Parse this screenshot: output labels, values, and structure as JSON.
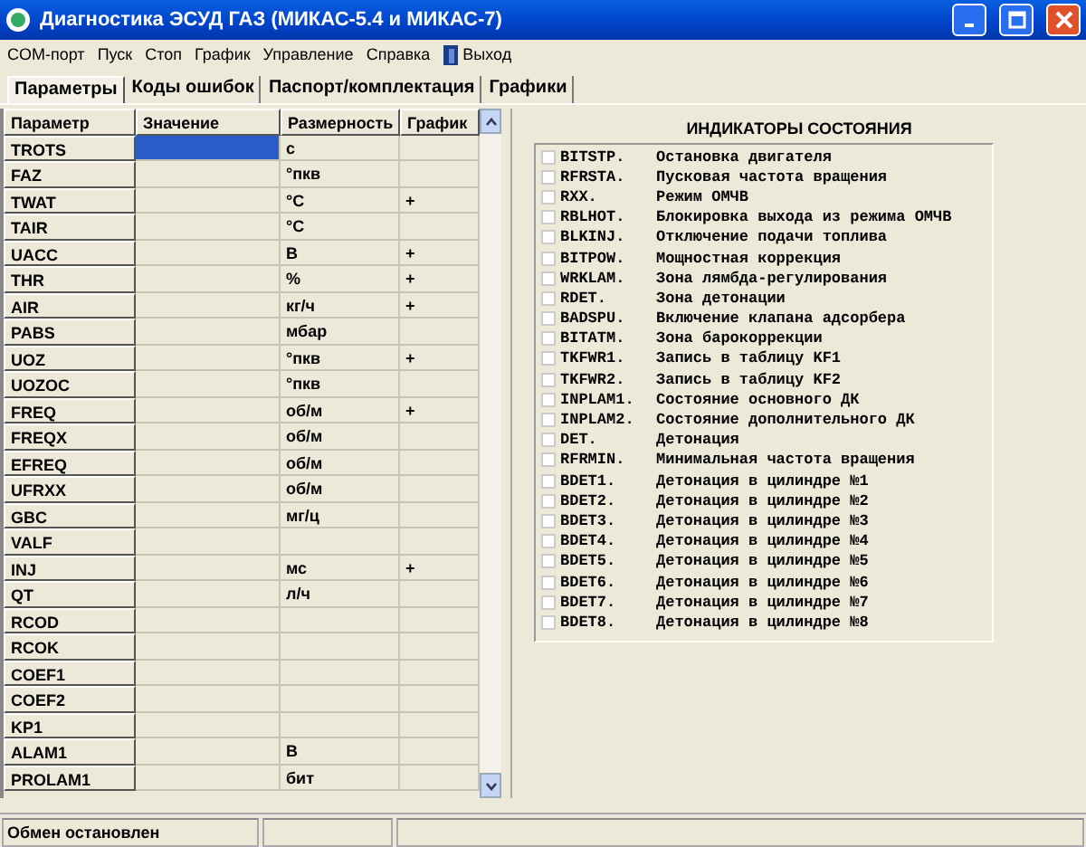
{
  "window": {
    "title": "Диагностика ЭСУД ГАЗ (МИКАС-5.4 и МИКАС-7)"
  },
  "menu": [
    "COM-порт",
    "Пуск",
    "Стоп",
    "График",
    "Управление",
    "Справка",
    "Выход"
  ],
  "tabs": [
    {
      "label": "Параметры",
      "selected": true
    },
    {
      "label": "Коды ошибок",
      "selected": false
    },
    {
      "label": "Паспорт/комплектация",
      "selected": false
    },
    {
      "label": "Графики",
      "selected": false
    }
  ],
  "table": {
    "columns": [
      "Параметр",
      "Значение",
      "Размерность",
      "График"
    ],
    "rows": [
      {
        "param": "TROTS",
        "unit": "с",
        "graph": "",
        "selected": true
      },
      {
        "param": "FAZ",
        "unit": "°пкв",
        "graph": "",
        "selected": false
      },
      {
        "param": "TWAT",
        "unit": "°C",
        "graph": "+",
        "selected": false
      },
      {
        "param": "TAIR",
        "unit": "°C",
        "graph": "",
        "selected": false
      },
      {
        "param": "UACC",
        "unit": "В",
        "graph": "+",
        "selected": false
      },
      {
        "param": "THR",
        "unit": "%",
        "graph": "+",
        "selected": false
      },
      {
        "param": "AIR",
        "unit": "кг/ч",
        "graph": "+",
        "selected": false
      },
      {
        "param": "PABS",
        "unit": "мбар",
        "graph": "",
        "selected": false
      },
      {
        "param": "UOZ",
        "unit": "°пкв",
        "graph": "+",
        "selected": false
      },
      {
        "param": "UOZOC",
        "unit": "°пкв",
        "graph": "",
        "selected": false
      },
      {
        "param": "FREQ",
        "unit": "об/м",
        "graph": "+",
        "selected": false
      },
      {
        "param": "FREQX",
        "unit": "об/м",
        "graph": "",
        "selected": false
      },
      {
        "param": "EFREQ",
        "unit": "об/м",
        "graph": "",
        "selected": false
      },
      {
        "param": "UFRXX",
        "unit": "об/м",
        "graph": "",
        "selected": false
      },
      {
        "param": "GBC",
        "unit": "мг/ц",
        "graph": "",
        "selected": false
      },
      {
        "param": "VALF",
        "unit": "",
        "graph": "",
        "selected": false
      },
      {
        "param": "INJ",
        "unit": "мс",
        "graph": "+",
        "selected": false
      },
      {
        "param": "QT",
        "unit": "л/ч",
        "graph": "",
        "selected": false
      },
      {
        "param": "RCOD",
        "unit": "",
        "graph": "",
        "selected": false
      },
      {
        "param": "RCOK",
        "unit": "",
        "graph": "",
        "selected": false
      },
      {
        "param": "COEF1",
        "unit": "",
        "graph": "",
        "selected": false
      },
      {
        "param": "COEF2",
        "unit": "",
        "graph": "",
        "selected": false
      },
      {
        "param": "KP1",
        "unit": "",
        "graph": "",
        "selected": false
      },
      {
        "param": "ALAM1",
        "unit": "В",
        "graph": "",
        "selected": false
      },
      {
        "param": "PROLAM1",
        "unit": "бит",
        "graph": "",
        "selected": false
      }
    ]
  },
  "indicators": {
    "title": "ИНДИКАТОРЫ СОСТОЯНИЯ",
    "items": [
      {
        "code": "BITSTP.",
        "text": "Остановка двигателя",
        "checked": false
      },
      {
        "code": "RFRSTA.",
        "text": "Пусковая частота вращения",
        "checked": false
      },
      {
        "code": "RXX.",
        "text": "Режим ОМЧВ",
        "checked": false
      },
      {
        "code": "RBLHOT.",
        "text": "Блокировка выхода из режима ОМЧВ",
        "checked": false
      },
      {
        "code": "BLKINJ.",
        "text": "Отключение подачи топлива",
        "checked": false
      },
      {
        "code": "BITPOW.",
        "text": "Мощностная коррекция",
        "checked": false
      },
      {
        "code": "WRKLAM.",
        "text": "Зона лямбда-регулирования",
        "checked": false
      },
      {
        "code": "RDET.",
        "text": "Зона детонации",
        "checked": false
      },
      {
        "code": "BADSPU.",
        "text": "Включение клапана адсорбера",
        "checked": false
      },
      {
        "code": "BITATM.",
        "text": "Зона барокоррекции",
        "checked": false
      },
      {
        "code": "TKFWR1.",
        "text": "Запись в таблицу KF1",
        "checked": false
      },
      {
        "code": "TKFWR2.",
        "text": "Запись в таблицу KF2",
        "checked": false
      },
      {
        "code": "INPLAM1.",
        "text": "Состояние основного ДК",
        "checked": false
      },
      {
        "code": "INPLAM2.",
        "text": "Состояние дополнительного ДК",
        "checked": false
      },
      {
        "code": "DET.",
        "text": "Детонация",
        "checked": false
      },
      {
        "code": "RFRMIN.",
        "text": "Минимальная частота вращения",
        "checked": false
      },
      {
        "code": "BDET1.",
        "text": "Детонация в цилиндре №1",
        "checked": false
      },
      {
        "code": "BDET2.",
        "text": "Детонация в цилиндре №2",
        "checked": false
      },
      {
        "code": "BDET3.",
        "text": "Детонация в цилиндре №3",
        "checked": false
      },
      {
        "code": "BDET4.",
        "text": "Детонация в цилиндре №4",
        "checked": false
      },
      {
        "code": "BDET5.",
        "text": "Детонация в цилиндре №5",
        "checked": false
      },
      {
        "code": "BDET6.",
        "text": "Детонация в цилиндре №6",
        "checked": false
      },
      {
        "code": "BDET7.",
        "text": "Детонация в цилиндре №7",
        "checked": false
      },
      {
        "code": "BDET8.",
        "text": "Детонация в цилиндре №8",
        "checked": false
      }
    ]
  },
  "status_bar": {
    "text": "Обмен остановлен"
  }
}
